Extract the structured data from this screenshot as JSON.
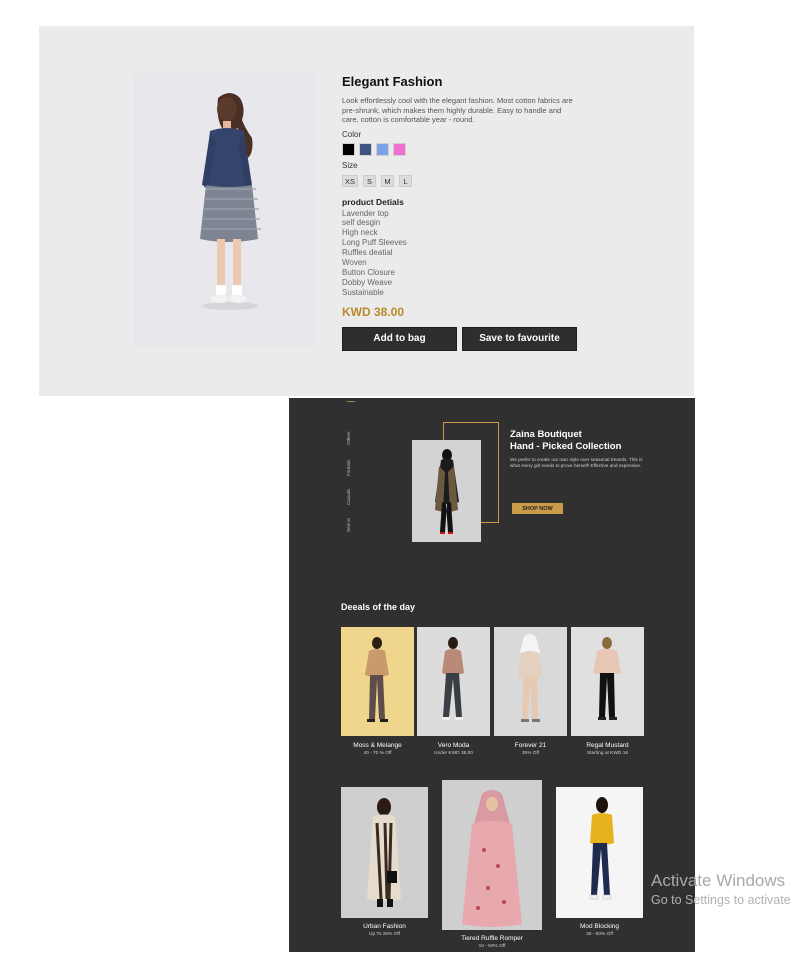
{
  "product": {
    "title": "Elegant Fashion",
    "description": "Look effortlessly cool with the elegant fashion. Most cotton fabrics are pre-shrunk, which makes them highly durable. Easy to handle and care, cotton is comfortable year - round.",
    "color_label": "Color",
    "colors": [
      "#000000",
      "#3d5580",
      "#7aa3e8",
      "#ef70cf"
    ],
    "size_label": "Size",
    "sizes": [
      "XS",
      "S",
      "M",
      "L"
    ],
    "details_heading": "product Detials",
    "details": [
      "Lavender top",
      "self desgin",
      "High neck",
      "Long Puff Sleeves",
      "Ruffles deatial",
      "Woven",
      "Button Closure",
      "Dobby Weave",
      "Sustainable"
    ],
    "price": "KWD 38.00",
    "add_to_bag": "Add to bag",
    "save_fav": "Save to favourite"
  },
  "store": {
    "nav": [
      "Others",
      "Formals",
      "Casuals",
      "New In"
    ],
    "hero": {
      "brand": "Zaina Boutiquet",
      "tagline": "Hand - Picked Collection",
      "copy": "We prefer to create our own style over seasonal treands. This is what every girl needs to prove herself! Effective and expensive.",
      "cta": "SHOP NOW"
    },
    "deals_title": "Deeals of the day",
    "deals": [
      {
        "name": "Moss & Melange",
        "sub": "40 - 70 % Off"
      },
      {
        "name": "Vero Moda",
        "sub": "Under KWD 38.00"
      },
      {
        "name": "Forever 21",
        "sub": "35% Off"
      },
      {
        "name": "Regal Mustard",
        "sub": "Starting at KWD 16"
      }
    ],
    "bottom": [
      {
        "name": "Urban Fashion",
        "sub": "Up To  26% Off"
      },
      {
        "name": "Tiered Ruffle Romper",
        "sub": "10 - 50% Off"
      },
      {
        "name": "Mod Blocking",
        "sub": "30 - 60% Off"
      }
    ]
  },
  "watermark": {
    "line1": "Activate Windows",
    "line2": "Go to Settings to activate Windows."
  }
}
